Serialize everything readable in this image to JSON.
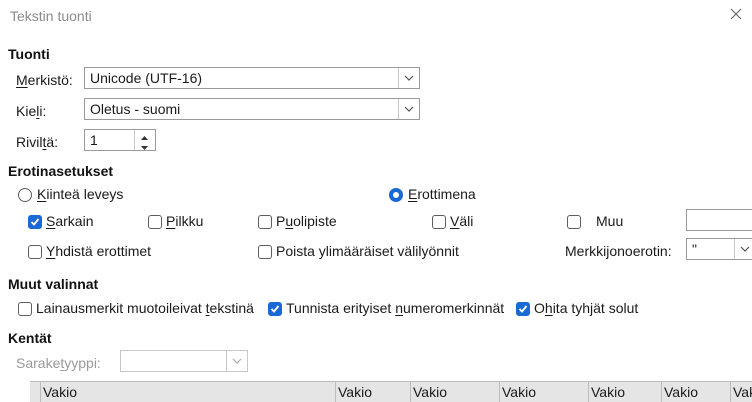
{
  "dialog": {
    "title": "Tekstin tuonti"
  },
  "import": {
    "heading": "Tuonti",
    "charset_label": "Merkistö:",
    "charset_value": "Unicode (UTF-16)",
    "language_label": "Kieli:",
    "language_value": "Oletus - suomi",
    "from_row_label": "Riviltä:",
    "from_row_value": "1"
  },
  "separator_options": {
    "heading": "Erotinasetukset",
    "fixed_width_label": "Kiinteä leveys",
    "fixed_width_selected": false,
    "separated_by_label": "Erottimena",
    "separated_by_selected": true,
    "tab": {
      "label": "Sarkain",
      "checked": true
    },
    "comma": {
      "label": "Pilkku",
      "checked": false
    },
    "semicolon": {
      "label": "Puolipiste",
      "checked": false
    },
    "space": {
      "label": "Väli",
      "checked": false
    },
    "other": {
      "label": "Muu",
      "checked": false,
      "value": ""
    },
    "merge_delimiters": {
      "label": "Yhdistä erottimet",
      "checked": false
    },
    "trim_spaces": {
      "label": "Poista ylimääräiset välilyönnit",
      "checked": false
    },
    "string_delimiter_label": "Merkkijonoerotin:",
    "string_delimiter_value": "\""
  },
  "other_options": {
    "heading": "Muut valinnat",
    "quoted_as_text": {
      "label": "Lainausmerkit muotoileivat tekstinä",
      "checked": false
    },
    "detect_special_numbers": {
      "label": "Tunnista erityiset numeromerkinnät",
      "checked": true
    },
    "skip_empty_cells": {
      "label": "Ohita tyhjät solut",
      "checked": true
    }
  },
  "fields": {
    "heading": "Kentät",
    "column_type_label": "Saraketyyppi:",
    "column_type_value": "",
    "columns": [
      "Vakio",
      "Vakio",
      "Vakio",
      "Vakio",
      "Vakio",
      "Vakio",
      "Vakio"
    ]
  },
  "colors": {
    "accent": "#1a6ad6"
  }
}
